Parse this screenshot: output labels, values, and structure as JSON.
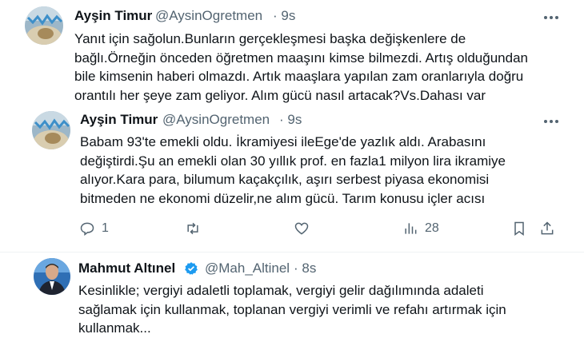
{
  "tweets": [
    {
      "author": "Ayşin Timur",
      "handle": "@AysinOgretmen",
      "time": "· 9s",
      "lines": [
        "Yanıt için sağolun.Bunların gerçekleşmesi başka değişkenlere de",
        "bağlı.Örneğin önceden öğretmen maaşını kimse bilmezdi. Artış olduğundan",
        "bile kimsenin haberi olmazdı. Artık maaşlara yapılan zam oranlarıyla doğru",
        "orantılı her şeye zam geliyor. Alım gücü nasıl artacak?Vs.Dahası var"
      ]
    },
    {
      "author": "Ayşin Timur",
      "handle": "@AysinOgretmen",
      "time": "· 9s",
      "lines": [
        "Babam 93'te emekli oldu. İkramiyesi ileEge'de yazlık aldı. Arabasını",
        "değiştirdi.Şu an emekli olan 30 yıllık prof. en fazla1 milyon lira ikramiye",
        "alıyor.Kara para, bilumum kaçakçılık, aşırı serbest piyasa ekonomisi",
        "bitmeden ne ekonomi düzelir,ne alım gücü. Tarım konusu içler acısı"
      ],
      "actions": {
        "reply_count": "1",
        "retweet_count": "",
        "like_count": "",
        "views_count": "28"
      }
    },
    {
      "author": "Mahmut Altınel",
      "handle": "@Mah_Altinel",
      "time": "· 8s",
      "verified_color": "#1d9bf0",
      "lines": [
        "Kesinlikle; vergiyi adaletli toplamak, vergiyi gelir dağılımında adaleti",
        "sağlamak için kullanmak, toplanan vergiyi verimli ve refahı artırmak için",
        "kullanmak..."
      ]
    }
  ],
  "colors": {
    "text": "#0f1419",
    "secondary": "#536471",
    "divider": "#eff3f4",
    "verified": "#1d9bf0"
  }
}
